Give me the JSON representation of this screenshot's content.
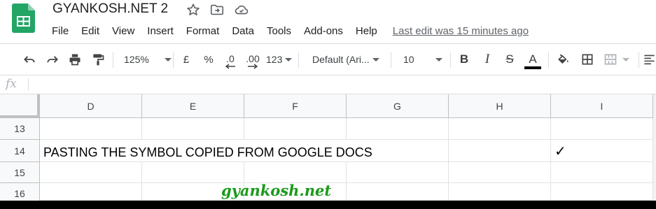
{
  "app": {
    "document_title": "GYANKOSH.NET 2",
    "icons": [
      "star-icon",
      "move-to-folder-icon",
      "cloud-saved-icon"
    ]
  },
  "menu": {
    "items": [
      "File",
      "Edit",
      "View",
      "Insert",
      "Format",
      "Data",
      "Tools",
      "Add-ons",
      "Help"
    ],
    "last_edit": "Last edit was 15 minutes ago"
  },
  "toolbar": {
    "zoom": "125%",
    "currency": "£",
    "percent": "%",
    "decrease_decimal": ".0",
    "increase_decimal": ".00",
    "more_formats": "123",
    "font": "Default (Ari...",
    "font_size": "10",
    "bold": "B",
    "italic": "I",
    "strikethrough": "S",
    "text_color_label": "A",
    "text_color": "#000000"
  },
  "formula_bar": {
    "fx": "fx",
    "content": ""
  },
  "grid": {
    "columns": [
      "D",
      "E",
      "F",
      "G",
      "H",
      "I"
    ],
    "rows": [
      "13",
      "14",
      "15",
      "16"
    ],
    "cells": {
      "D14": "PASTING THE SYMBOL COPIED FROM GOOGLE DOCS",
      "I14": "✓"
    }
  },
  "watermark": "gyankosh.net",
  "colors": {
    "sheets_green": "#0f9d58",
    "header_bg": "#f8f9fa",
    "watermark_green": "#1a9a1a"
  }
}
